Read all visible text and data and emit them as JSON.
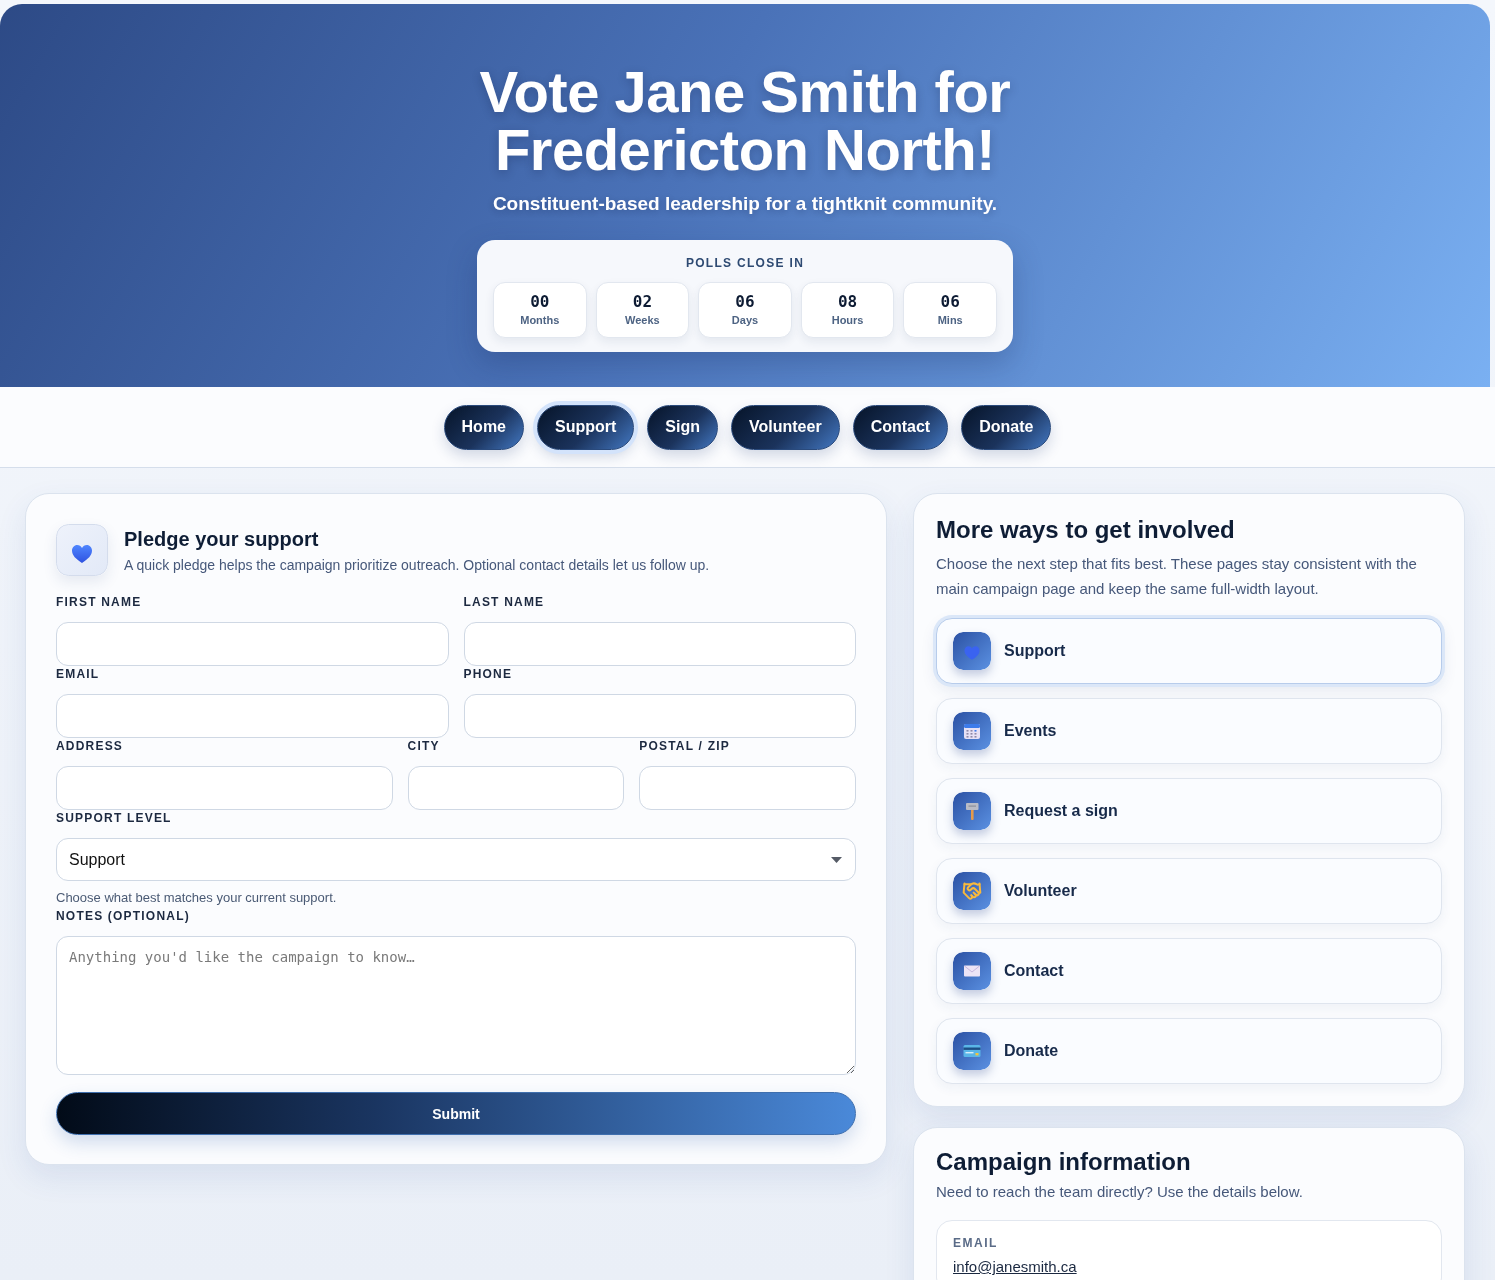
{
  "hero": {
    "title": "Vote Jane Smith for Fredericton North!",
    "subtitle": "Constituent-based leadership for a tightknit community.",
    "countdown": {
      "label": "POLLS CLOSE IN",
      "units": [
        {
          "value": "00",
          "unit": "Months"
        },
        {
          "value": "02",
          "unit": "Weeks"
        },
        {
          "value": "06",
          "unit": "Days"
        },
        {
          "value": "08",
          "unit": "Hours"
        },
        {
          "value": "06",
          "unit": "Mins"
        }
      ]
    }
  },
  "nav": [
    {
      "label": "Home",
      "selected": false
    },
    {
      "label": "Support",
      "selected": true
    },
    {
      "label": "Sign",
      "selected": false
    },
    {
      "label": "Volunteer",
      "selected": false
    },
    {
      "label": "Contact",
      "selected": false
    },
    {
      "label": "Donate",
      "selected": false
    }
  ],
  "pledge": {
    "title": "Pledge your support",
    "description": "A quick pledge helps the campaign prioritize outreach. Optional contact details let us follow up.",
    "rows": [
      {
        "fields": [
          {
            "label": "FIRST NAME"
          },
          {
            "label": "LAST NAME"
          }
        ]
      },
      {
        "fields": [
          {
            "label": "EMAIL"
          },
          {
            "label": "PHONE"
          }
        ]
      },
      {
        "fields": [
          {
            "label": "ADDRESS"
          },
          {
            "label": "CITY"
          },
          {
            "label": "POSTAL / ZIP"
          }
        ]
      }
    ],
    "support_level": {
      "label": "SUPPORT LEVEL",
      "value": "Support",
      "hint": "Choose what best matches your current support."
    },
    "notes": {
      "label": "NOTES (OPTIONAL)",
      "placeholder": "Anything you'd like the campaign to know…"
    },
    "submit": "Submit"
  },
  "involved": {
    "title": "More ways to get involved",
    "description": "Choose the next step that fits best. These pages stay consistent with the main campaign page and keep the same full-width layout.",
    "links": [
      {
        "label": "Support",
        "selected": true
      },
      {
        "label": "Events",
        "selected": false
      },
      {
        "label": "Request a sign",
        "selected": false
      },
      {
        "label": "Volunteer",
        "selected": false
      },
      {
        "label": "Contact",
        "selected": false
      },
      {
        "label": "Donate",
        "selected": false
      }
    ]
  },
  "campaign_info": {
    "title": "Campaign information",
    "description": "Need to reach the team directly? Use the details below.",
    "details": [
      {
        "label": "EMAIL",
        "value": "info@janesmith.ca"
      }
    ]
  }
}
